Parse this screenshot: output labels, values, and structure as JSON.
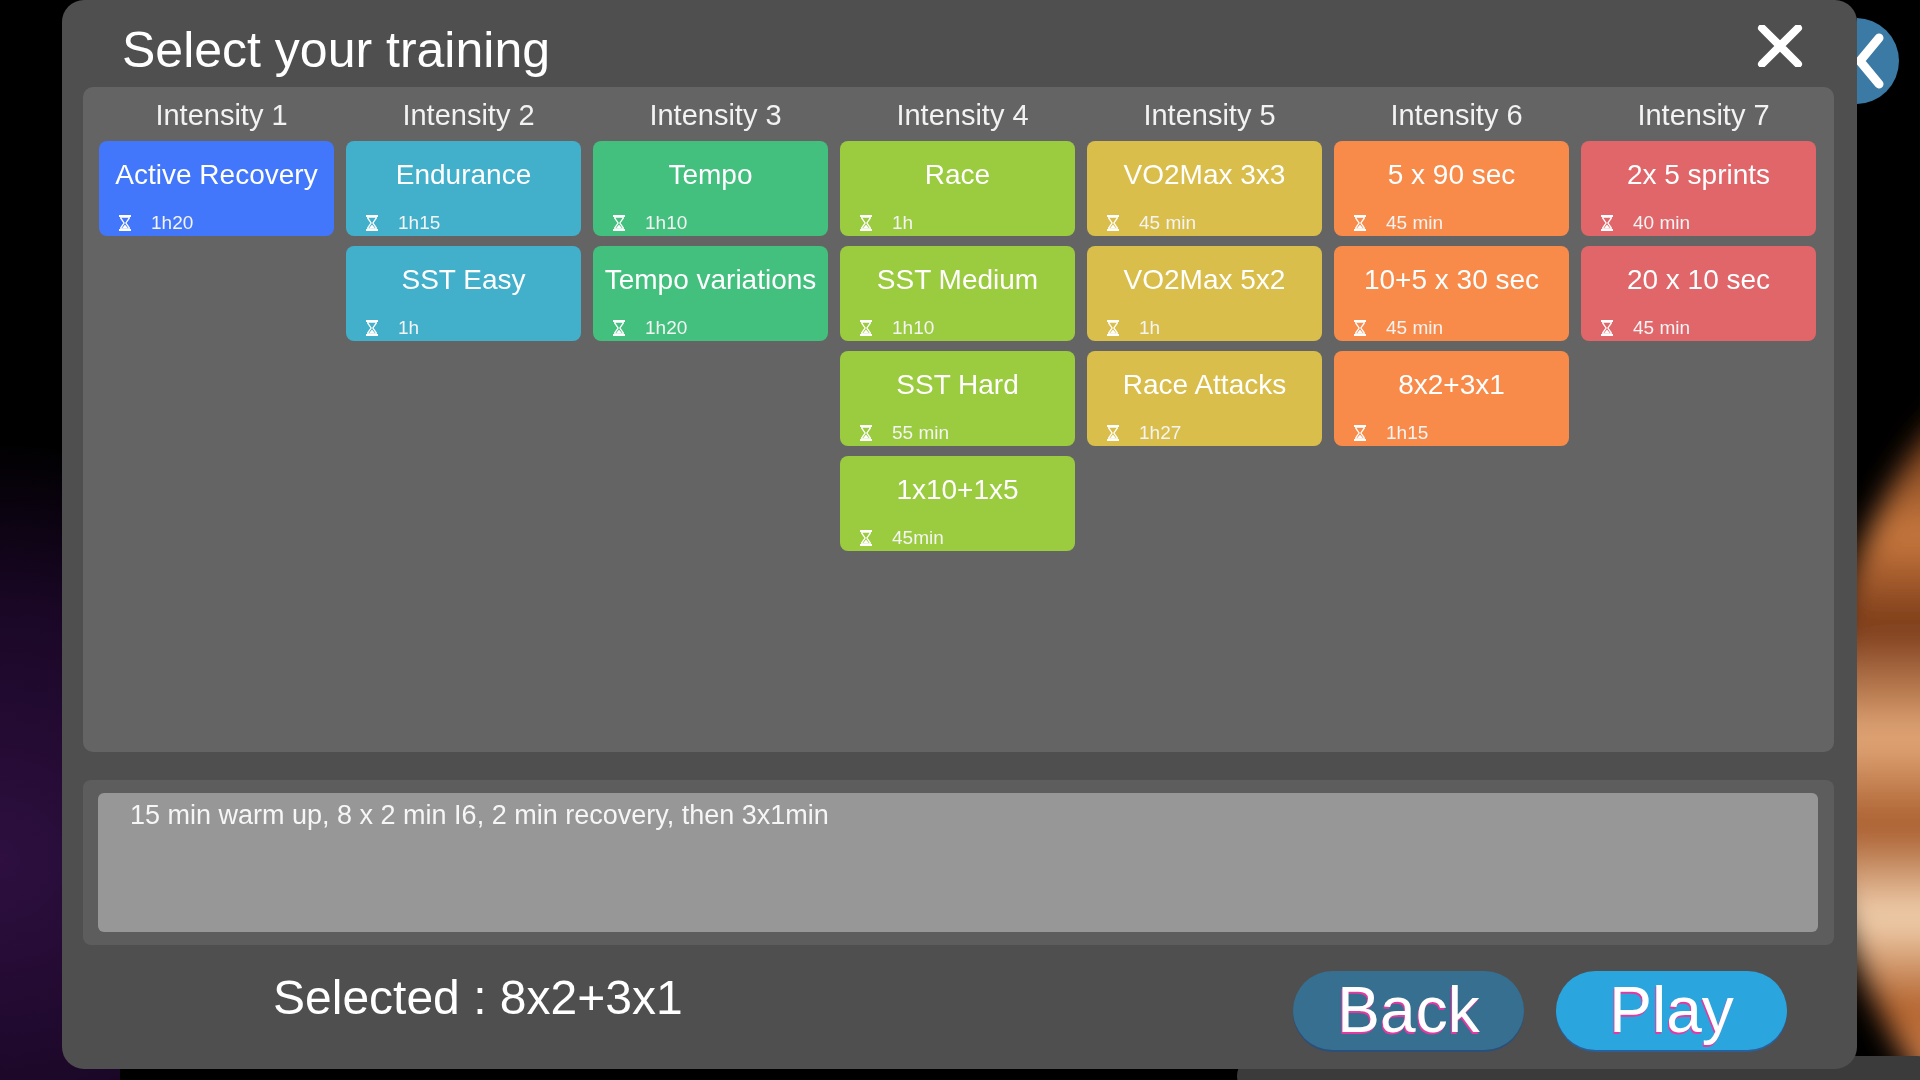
{
  "dialog": {
    "title": "Select your training"
  },
  "columns": [
    {
      "heading": "Intensity 1",
      "color": "#4276fb",
      "trainings": [
        {
          "name": "Active Recovery",
          "duration": "1h20"
        }
      ]
    },
    {
      "heading": "Intensity 2",
      "color": "#42afcb",
      "trainings": [
        {
          "name": "Endurance",
          "duration": "1h15"
        },
        {
          "name": "SST Easy",
          "duration": "1h"
        }
      ]
    },
    {
      "heading": "Intensity 3",
      "color": "#43bf7e",
      "trainings": [
        {
          "name": "Tempo",
          "duration": "1h10"
        },
        {
          "name": "Tempo variations",
          "duration": "1h20"
        }
      ]
    },
    {
      "heading": "Intensity 4",
      "color": "#9bcb3f",
      "trainings": [
        {
          "name": "Race",
          "duration": "1h"
        },
        {
          "name": "SST Medium",
          "duration": "1h10"
        },
        {
          "name": "SST Hard",
          "duration": "55 min"
        },
        {
          "name": "1x10+1x5",
          "duration": "45min"
        }
      ]
    },
    {
      "heading": "Intensity 5",
      "color": "#dabe4b",
      "trainings": [
        {
          "name": "VO2Max 3x3",
          "duration": "45 min"
        },
        {
          "name": "VO2Max 5x2",
          "duration": "1h"
        },
        {
          "name": "Race Attacks",
          "duration": "1h27"
        }
      ]
    },
    {
      "heading": "Intensity 6",
      "color": "#f88b4a",
      "trainings": [
        {
          "name": "5 x 90 sec",
          "duration": "45 min"
        },
        {
          "name": "10+5 x 30 sec",
          "duration": "45 min"
        },
        {
          "name": "8x2+3x1",
          "duration": "1h15"
        }
      ]
    },
    {
      "heading": "Intensity 7",
      "color": "#e1666a",
      "trainings": [
        {
          "name": "2x 5 sprints",
          "duration": "40 min"
        },
        {
          "name": "20 x 10 sec",
          "duration": "45 min"
        }
      ]
    }
  ],
  "description": "15 min warm up, 8 x 2 min I6, 2 min recovery, then 3x1min",
  "selected_label": "Selected : 8x2+3x1",
  "buttons": [
    {
      "label": "Back",
      "kind": "back"
    },
    {
      "label": "Play",
      "kind": "play"
    }
  ]
}
